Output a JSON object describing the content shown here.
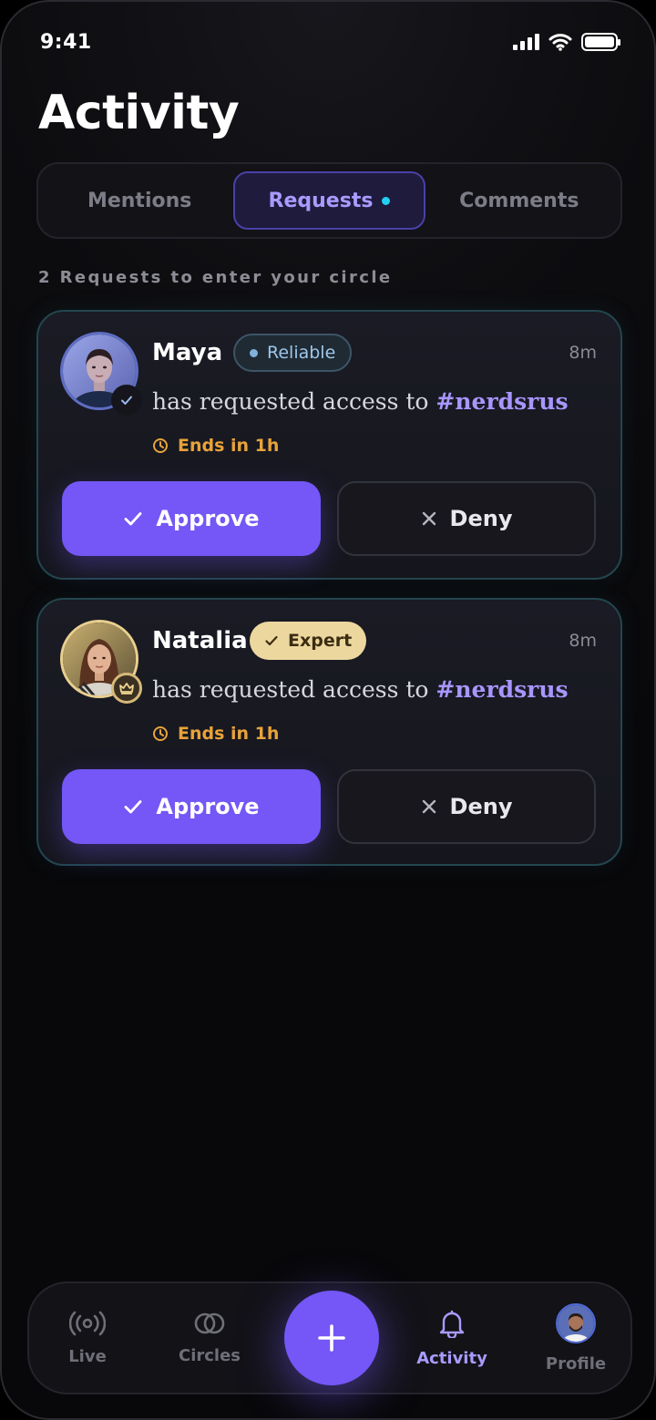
{
  "status_bar": {
    "time": "9:41",
    "battery_level": 1.0
  },
  "page": {
    "title": "Activity"
  },
  "tabs": [
    {
      "label": "Mentions",
      "active": false
    },
    {
      "label": "Requests",
      "active": true,
      "has_dot": true
    },
    {
      "label": "Comments",
      "active": false
    }
  ],
  "section_label": "2 Requests to enter your circle",
  "requests": [
    {
      "name": "Maya",
      "badge": "Reliable",
      "time": "8m",
      "text_prefix": "has requested access to",
      "circle": "#nerdsrus",
      "ends": "Ends in 1h",
      "approve_label": "Approve",
      "deny_label": "Deny"
    },
    {
      "name": "Natalia",
      "badge": "Expert",
      "time": "8m",
      "text_prefix": "has requested access to",
      "circle": "#nerdsrus",
      "ends": "Ends in 1h",
      "approve_label": "Approve",
      "deny_label": "Deny"
    }
  ],
  "nav": {
    "live": "Live",
    "circles": "Circles",
    "activity": "Activity",
    "profile": "Profile",
    "active": "Activity"
  },
  "colors": {
    "accent": "#7457f6",
    "accent_text": "#a99bff",
    "warning": "#e8a33a",
    "expert_badge": "#ecd79f",
    "tab_dot": "#22d0f2"
  },
  "icons": [
    "signal-icon",
    "wifi-icon",
    "battery-icon",
    "verified-icon",
    "crown-icon",
    "clock-icon",
    "check-icon",
    "x-icon",
    "broadcast-icon",
    "circles-icon",
    "plus-icon",
    "bell-icon"
  ]
}
